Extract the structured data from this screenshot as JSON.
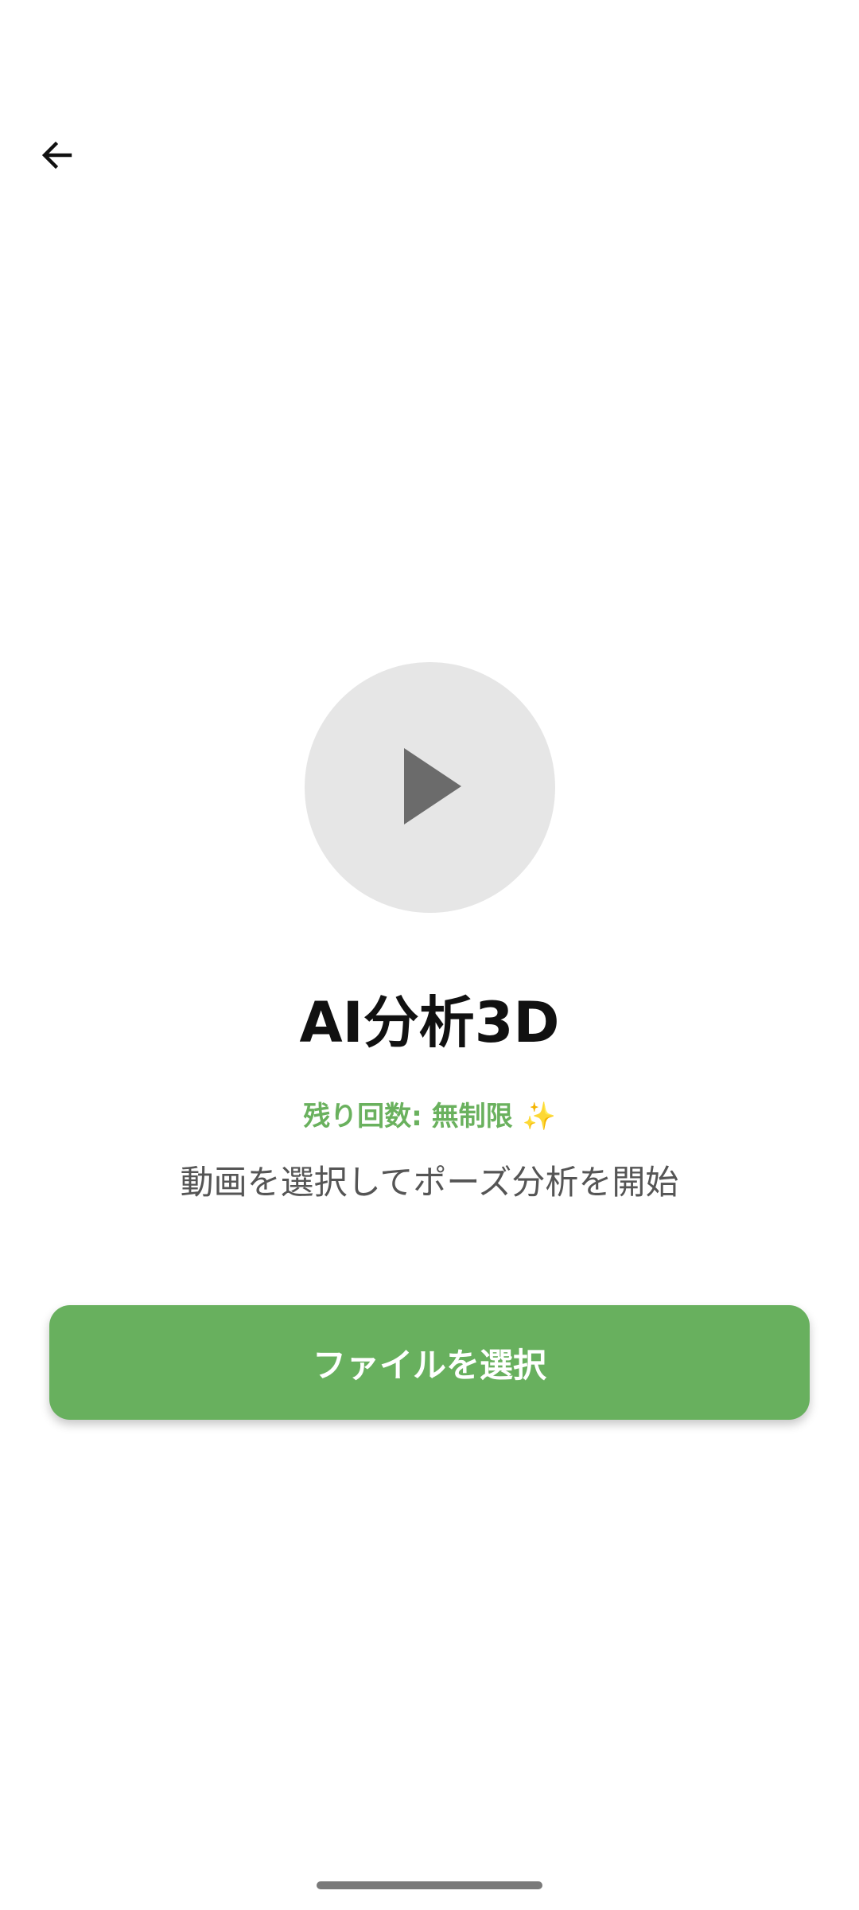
{
  "header": {
    "back_icon": "arrow-left-icon"
  },
  "media": {
    "play_icon": "play-icon"
  },
  "main": {
    "title": "AI分析3D",
    "remaining_label": "残り回数: 無制限",
    "remaining_emoji": "✨",
    "subtitle": "動画を選択してポーズ分析を開始",
    "select_button_label": "ファイルを選択"
  },
  "colors": {
    "accent": "#68b05e",
    "remaining_text": "#6ab15e",
    "sparkle": "#f3c431",
    "circle_bg": "#e6e6e6",
    "play_icon": "#6b6b6b"
  }
}
